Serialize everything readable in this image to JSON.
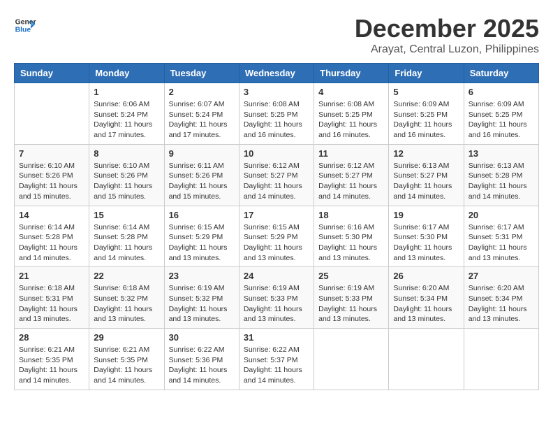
{
  "header": {
    "logo_line1": "General",
    "logo_line2": "Blue",
    "month": "December 2025",
    "location": "Arayat, Central Luzon, Philippines"
  },
  "weekdays": [
    "Sunday",
    "Monday",
    "Tuesday",
    "Wednesday",
    "Thursday",
    "Friday",
    "Saturday"
  ],
  "weeks": [
    [
      {
        "day": "",
        "sunrise": "",
        "sunset": "",
        "daylight": ""
      },
      {
        "day": "1",
        "sunrise": "Sunrise: 6:06 AM",
        "sunset": "Sunset: 5:24 PM",
        "daylight": "Daylight: 11 hours and 17 minutes."
      },
      {
        "day": "2",
        "sunrise": "Sunrise: 6:07 AM",
        "sunset": "Sunset: 5:24 PM",
        "daylight": "Daylight: 11 hours and 17 minutes."
      },
      {
        "day": "3",
        "sunrise": "Sunrise: 6:08 AM",
        "sunset": "Sunset: 5:25 PM",
        "daylight": "Daylight: 11 hours and 16 minutes."
      },
      {
        "day": "4",
        "sunrise": "Sunrise: 6:08 AM",
        "sunset": "Sunset: 5:25 PM",
        "daylight": "Daylight: 11 hours and 16 minutes."
      },
      {
        "day": "5",
        "sunrise": "Sunrise: 6:09 AM",
        "sunset": "Sunset: 5:25 PM",
        "daylight": "Daylight: 11 hours and 16 minutes."
      },
      {
        "day": "6",
        "sunrise": "Sunrise: 6:09 AM",
        "sunset": "Sunset: 5:25 PM",
        "daylight": "Daylight: 11 hours and 16 minutes."
      }
    ],
    [
      {
        "day": "7",
        "sunrise": "Sunrise: 6:10 AM",
        "sunset": "Sunset: 5:26 PM",
        "daylight": "Daylight: 11 hours and 15 minutes."
      },
      {
        "day": "8",
        "sunrise": "Sunrise: 6:10 AM",
        "sunset": "Sunset: 5:26 PM",
        "daylight": "Daylight: 11 hours and 15 minutes."
      },
      {
        "day": "9",
        "sunrise": "Sunrise: 6:11 AM",
        "sunset": "Sunset: 5:26 PM",
        "daylight": "Daylight: 11 hours and 15 minutes."
      },
      {
        "day": "10",
        "sunrise": "Sunrise: 6:12 AM",
        "sunset": "Sunset: 5:27 PM",
        "daylight": "Daylight: 11 hours and 14 minutes."
      },
      {
        "day": "11",
        "sunrise": "Sunrise: 6:12 AM",
        "sunset": "Sunset: 5:27 PM",
        "daylight": "Daylight: 11 hours and 14 minutes."
      },
      {
        "day": "12",
        "sunrise": "Sunrise: 6:13 AM",
        "sunset": "Sunset: 5:27 PM",
        "daylight": "Daylight: 11 hours and 14 minutes."
      },
      {
        "day": "13",
        "sunrise": "Sunrise: 6:13 AM",
        "sunset": "Sunset: 5:28 PM",
        "daylight": "Daylight: 11 hours and 14 minutes."
      }
    ],
    [
      {
        "day": "14",
        "sunrise": "Sunrise: 6:14 AM",
        "sunset": "Sunset: 5:28 PM",
        "daylight": "Daylight: 11 hours and 14 minutes."
      },
      {
        "day": "15",
        "sunrise": "Sunrise: 6:14 AM",
        "sunset": "Sunset: 5:28 PM",
        "daylight": "Daylight: 11 hours and 14 minutes."
      },
      {
        "day": "16",
        "sunrise": "Sunrise: 6:15 AM",
        "sunset": "Sunset: 5:29 PM",
        "daylight": "Daylight: 11 hours and 13 minutes."
      },
      {
        "day": "17",
        "sunrise": "Sunrise: 6:15 AM",
        "sunset": "Sunset: 5:29 PM",
        "daylight": "Daylight: 11 hours and 13 minutes."
      },
      {
        "day": "18",
        "sunrise": "Sunrise: 6:16 AM",
        "sunset": "Sunset: 5:30 PM",
        "daylight": "Daylight: 11 hours and 13 minutes."
      },
      {
        "day": "19",
        "sunrise": "Sunrise: 6:17 AM",
        "sunset": "Sunset: 5:30 PM",
        "daylight": "Daylight: 11 hours and 13 minutes."
      },
      {
        "day": "20",
        "sunrise": "Sunrise: 6:17 AM",
        "sunset": "Sunset: 5:31 PM",
        "daylight": "Daylight: 11 hours and 13 minutes."
      }
    ],
    [
      {
        "day": "21",
        "sunrise": "Sunrise: 6:18 AM",
        "sunset": "Sunset: 5:31 PM",
        "daylight": "Daylight: 11 hours and 13 minutes."
      },
      {
        "day": "22",
        "sunrise": "Sunrise: 6:18 AM",
        "sunset": "Sunset: 5:32 PM",
        "daylight": "Daylight: 11 hours and 13 minutes."
      },
      {
        "day": "23",
        "sunrise": "Sunrise: 6:19 AM",
        "sunset": "Sunset: 5:32 PM",
        "daylight": "Daylight: 11 hours and 13 minutes."
      },
      {
        "day": "24",
        "sunrise": "Sunrise: 6:19 AM",
        "sunset": "Sunset: 5:33 PM",
        "daylight": "Daylight: 11 hours and 13 minutes."
      },
      {
        "day": "25",
        "sunrise": "Sunrise: 6:19 AM",
        "sunset": "Sunset: 5:33 PM",
        "daylight": "Daylight: 11 hours and 13 minutes."
      },
      {
        "day": "26",
        "sunrise": "Sunrise: 6:20 AM",
        "sunset": "Sunset: 5:34 PM",
        "daylight": "Daylight: 11 hours and 13 minutes."
      },
      {
        "day": "27",
        "sunrise": "Sunrise: 6:20 AM",
        "sunset": "Sunset: 5:34 PM",
        "daylight": "Daylight: 11 hours and 13 minutes."
      }
    ],
    [
      {
        "day": "28",
        "sunrise": "Sunrise: 6:21 AM",
        "sunset": "Sunset: 5:35 PM",
        "daylight": "Daylight: 11 hours and 14 minutes."
      },
      {
        "day": "29",
        "sunrise": "Sunrise: 6:21 AM",
        "sunset": "Sunset: 5:35 PM",
        "daylight": "Daylight: 11 hours and 14 minutes."
      },
      {
        "day": "30",
        "sunrise": "Sunrise: 6:22 AM",
        "sunset": "Sunset: 5:36 PM",
        "daylight": "Daylight: 11 hours and 14 minutes."
      },
      {
        "day": "31",
        "sunrise": "Sunrise: 6:22 AM",
        "sunset": "Sunset: 5:37 PM",
        "daylight": "Daylight: 11 hours and 14 minutes."
      },
      {
        "day": "",
        "sunrise": "",
        "sunset": "",
        "daylight": ""
      },
      {
        "day": "",
        "sunrise": "",
        "sunset": "",
        "daylight": ""
      },
      {
        "day": "",
        "sunrise": "",
        "sunset": "",
        "daylight": ""
      }
    ]
  ]
}
